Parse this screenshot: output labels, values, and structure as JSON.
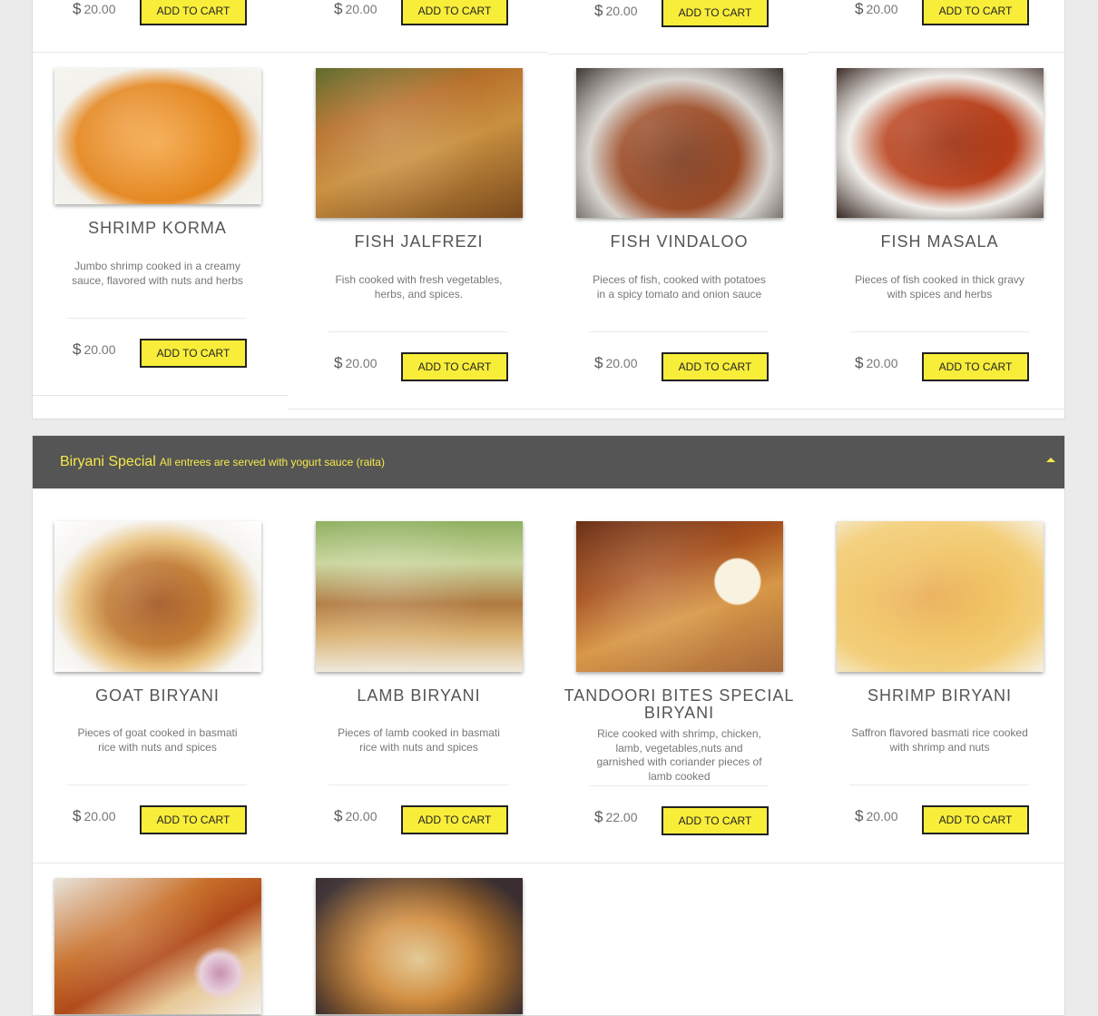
{
  "top_row": [
    {
      "price": "20.00",
      "button": "ADD TO CART"
    },
    {
      "price": "20.00",
      "button": "ADD TO CART"
    },
    {
      "price": "20.00",
      "button": "ADD TO CART"
    },
    {
      "price": "20.00",
      "button": "ADD TO CART"
    }
  ],
  "seafood_row": [
    {
      "name": "SHRIMP KORMA",
      "description": "Jumbo shrimp cooked in a creamy sauce, flavored with nuts and herbs",
      "price": "20.00",
      "button": "ADD TO CART"
    },
    {
      "name": "FISH JALFREZI",
      "description": "Fish cooked with fresh vegetables, herbs, and spices.",
      "price": "20.00",
      "button": "ADD TO CART"
    },
    {
      "name": "FISH VINDALOO",
      "description": "Pieces of fish, cooked with potatoes in a spicy tomato and onion sauce",
      "price": "20.00",
      "button": "ADD TO CART"
    },
    {
      "name": "FISH MASALA",
      "description": "Pieces of fish cooked in thick gravy with spices and herbs",
      "price": "20.00",
      "button": "ADD TO CART"
    }
  ],
  "biryani": {
    "title": "Biryani Special",
    "subtitle": "All entrees are served with yogurt sauce (raita)",
    "items": [
      {
        "name": "GOAT BIRYANI",
        "description": "Pieces of goat cooked in basmati rice with nuts and spices",
        "price": "20.00",
        "button": "ADD TO CART"
      },
      {
        "name": "LAMB BIRYANI",
        "description": "Pieces of lamb cooked in basmati rice with nuts and spices",
        "price": "20.00",
        "button": "ADD TO CART"
      },
      {
        "name": "TANDOORI BITES SPECIAL BIRYANI",
        "description": "Rice cooked with shrimp, chicken, lamb, vegetables,nuts and garnished with coriander pieces of lamb cooked",
        "price": "22.00",
        "button": "ADD TO CART"
      },
      {
        "name": "SHRIMP BIRYANI",
        "description": "Saffron flavored basmati rice cooked with shrimp and nuts",
        "price": "20.00",
        "button": "ADD TO CART"
      }
    ]
  },
  "currency_symbol": "$",
  "colors": {
    "accent_yellow": "#f8ee3a",
    "header_bg": "#555555",
    "header_text": "#f5e94a"
  }
}
